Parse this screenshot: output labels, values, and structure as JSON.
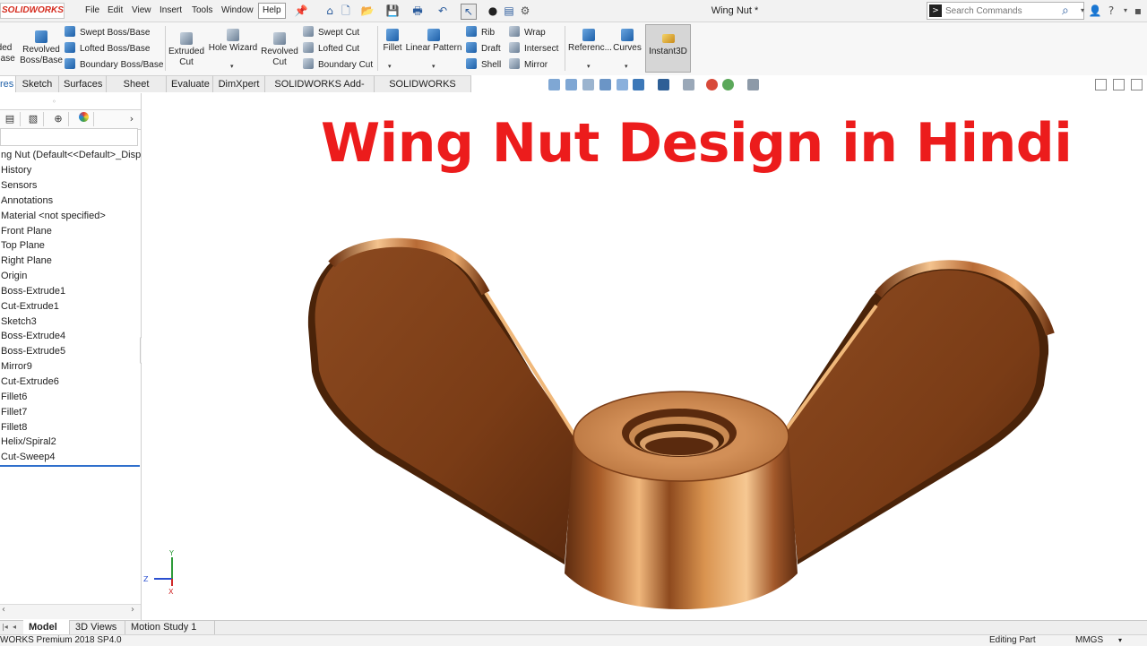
{
  "app": {
    "logo_text": "SOLIDWORKS",
    "document_title": "Wing Nut *",
    "brand_color": "#d52b1e"
  },
  "menu": [
    "File",
    "Edit",
    "View",
    "Insert",
    "Tools",
    "Window",
    "Help"
  ],
  "search": {
    "placeholder": "Search Commands"
  },
  "commands": {
    "extruded_boss_partial": "ded\nBase",
    "revolved_boss": "Revolved\nBoss/Base",
    "swept_boss": "Swept Boss/Base",
    "lofted_boss": "Lofted Boss/Base",
    "boundary_boss": "Boundary Boss/Base",
    "extruded_cut": "Extruded\nCut",
    "hole_wizard": "Hole Wizard",
    "revolved_cut": "Revolved\nCut",
    "swept_cut": "Swept Cut",
    "lofted_cut": "Lofted Cut",
    "boundary_cut": "Boundary Cut",
    "fillet": "Fillet",
    "linear_pattern": "Linear Pattern",
    "rib": "Rib",
    "draft": "Draft",
    "shell": "Shell",
    "wrap": "Wrap",
    "intersect": "Intersect",
    "mirror": "Mirror",
    "reference": "Referenc...",
    "curves": "Curves",
    "instant3d": "Instant3D"
  },
  "tabs": [
    "res",
    "Sketch",
    "Surfaces",
    "Sheet Metal",
    "Evaluate",
    "DimXpert",
    "SOLIDWORKS Add-Ins",
    "SOLIDWORKS MBD"
  ],
  "feature_tree": {
    "root": "ng Nut  (Default<<Default>_Displ",
    "items": [
      "History",
      "Sensors",
      "Annotations",
      "Material <not specified>",
      "Front Plane",
      "Top Plane",
      "Right Plane",
      "Origin",
      "Boss-Extrude1",
      "Cut-Extrude1",
      "Sketch3",
      "Boss-Extrude4",
      "Boss-Extrude5",
      "Mirror9",
      "Cut-Extrude6",
      "Fillet6",
      "Fillet7",
      "Fillet8",
      "Helix/Spiral2",
      "Cut-Sweep4"
    ]
  },
  "overlay": {
    "headline": "Wing Nut Design in Hindi",
    "headline_color": "#ec1c1c"
  },
  "triad": {
    "x": "X",
    "y": "Y",
    "z": "Z"
  },
  "bottom_tabs": [
    "Model",
    "3D Views",
    "Motion Study 1"
  ],
  "status": {
    "version": "WORKS Premium 2018 SP4.0",
    "mode": "Editing Part",
    "units": "MMGS"
  },
  "colors": {
    "copper_light": "#f4c38e",
    "copper_mid": "#b86b36",
    "copper_dark": "#6e3412"
  }
}
